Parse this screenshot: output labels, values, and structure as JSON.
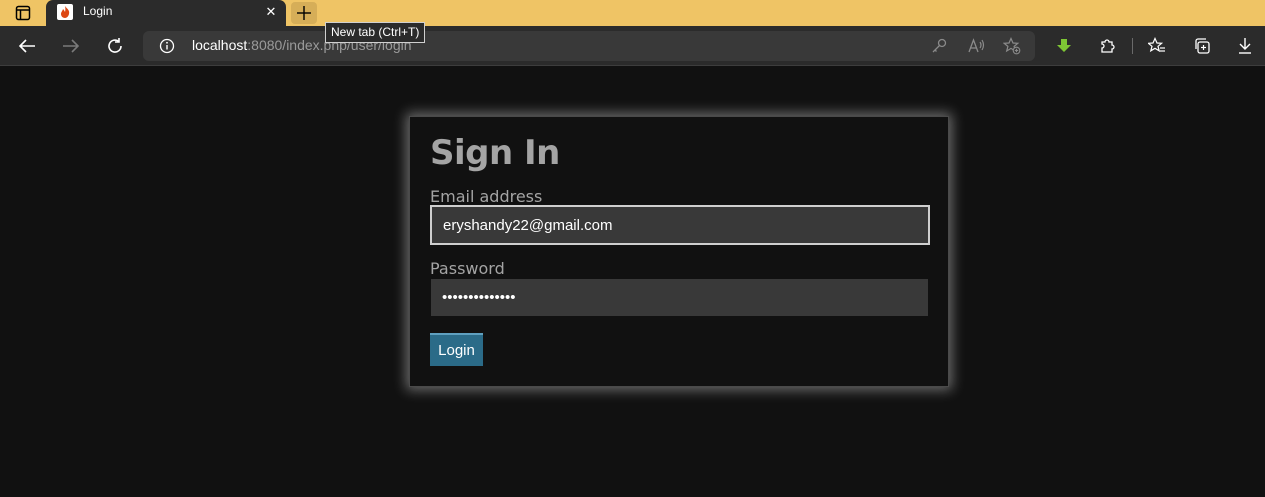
{
  "browser": {
    "tab": {
      "title": "Login"
    },
    "tooltip": "New tab (Ctrl+T)",
    "address": {
      "host": "localhost",
      "rest": ":8080/index.php/user/login"
    }
  },
  "colors": {
    "titlebar": "#efc465",
    "button": "#2b6b88",
    "text_muted": "#a4a4a4",
    "download_icon": "#7ec634"
  },
  "icons": {
    "tab_actions": "tab-actions-icon",
    "favicon": "codeigniter-flame-icon",
    "close": "close-icon",
    "new_tab": "plus-icon",
    "back": "arrow-left-icon",
    "forward": "arrow-right-icon",
    "refresh": "refresh-icon",
    "info": "info-icon",
    "key": "key-icon",
    "read_aloud": "read-aloud-icon",
    "favorite_add": "star-plus-icon",
    "download_extension": "download-arrow-icon",
    "extensions": "puzzle-icon",
    "favorites": "favorites-icon",
    "collections": "collections-icon",
    "downloads": "download-icon"
  },
  "form": {
    "title": "Sign In",
    "email_label": "Email address",
    "email_value": "eryshandy22@gmail.com",
    "password_label": "Password",
    "password_value": "••••••••••••••",
    "submit_label": "Login"
  }
}
